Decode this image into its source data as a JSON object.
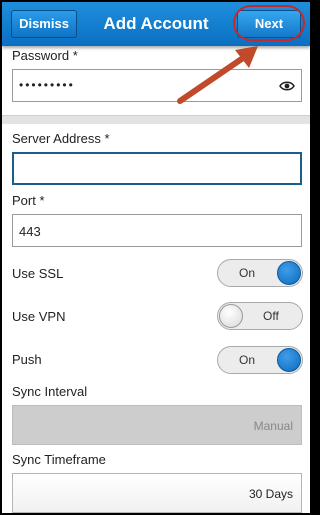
{
  "header": {
    "dismiss_label": "Dismiss",
    "title": "Add Account",
    "next_label": "Next"
  },
  "form": {
    "password": {
      "label": "Password *",
      "value": "•••••••••"
    },
    "server_address": {
      "label": "Server Address *",
      "value": ""
    },
    "port": {
      "label": "Port *",
      "value": "443"
    },
    "use_ssl": {
      "label": "Use SSL",
      "state": "On"
    },
    "use_vpn": {
      "label": "Use VPN",
      "state": "Off"
    },
    "push": {
      "label": "Push",
      "state": "On"
    },
    "sync_interval": {
      "label": "Sync Interval",
      "value": "Manual"
    },
    "sync_timeframe": {
      "label": "Sync Timeframe",
      "value": "30 Days"
    }
  },
  "icons": {
    "password_toggle": "eye-icon",
    "annotation": "arrow-annotation"
  },
  "colors": {
    "header": "#0a6fc2",
    "annotation": "#c82828",
    "toggle_on": "#0d6bbf"
  }
}
